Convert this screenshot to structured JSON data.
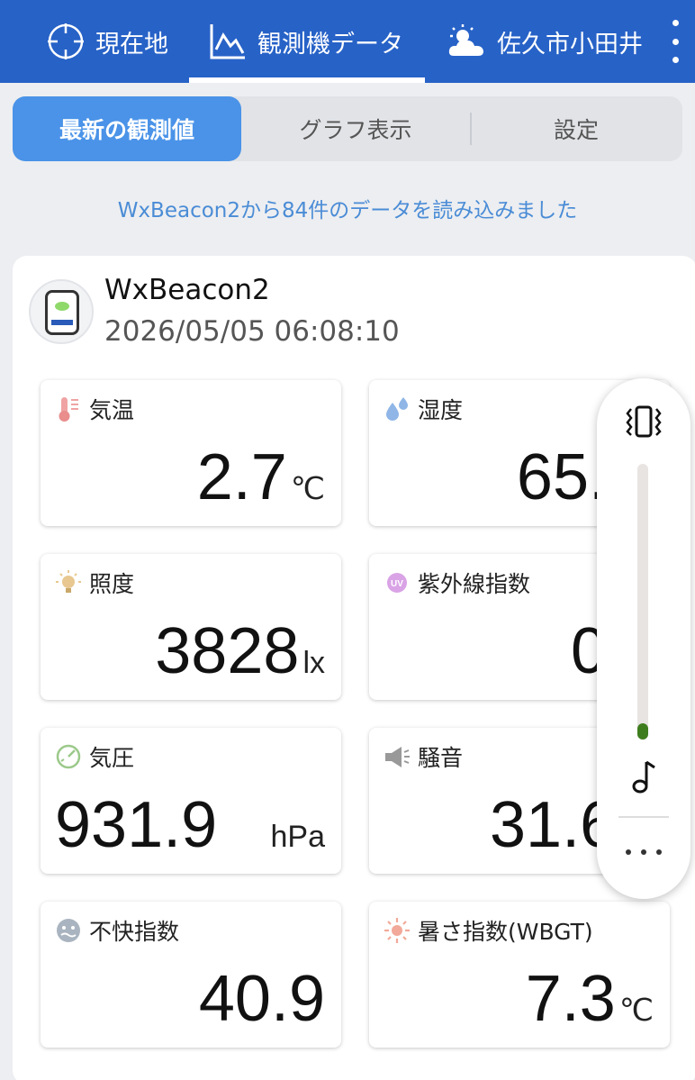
{
  "appbar": {
    "tabs": [
      {
        "label": "現在地",
        "icon": "crosshair-icon"
      },
      {
        "label": "観測機データ",
        "icon": "line-chart-icon"
      },
      {
        "label": "佐久市小田井",
        "icon": "partly-cloudy-icon"
      }
    ],
    "active_tab": 1
  },
  "segment": {
    "latest": "最新の観測値",
    "graph": "グラフ表示",
    "settings": "設定",
    "active": "latest"
  },
  "status_message": "WxBeacon2から84件のデータを読み込みました",
  "device": {
    "name": "WxBeacon2",
    "timestamp": "2026/05/05 06:08:10"
  },
  "metrics": {
    "temperature": {
      "label": "気温",
      "value": "2.7",
      "unit": "℃",
      "icon": "thermometer-icon"
    },
    "humidity": {
      "label": "湿度",
      "value": "65.",
      "unit": "",
      "icon": "water-drops-icon"
    },
    "illuminance": {
      "label": "照度",
      "value": "3828",
      "unit": "lx",
      "icon": "light-bulb-icon"
    },
    "uv": {
      "label": "紫外線指数",
      "value": "0",
      "unit": "",
      "icon": "uv-icon"
    },
    "pressure": {
      "label": "気圧",
      "value": "931.9",
      "unit": "hPa",
      "icon": "gauge-icon"
    },
    "noise": {
      "label": "騒音",
      "value": "31.6",
      "unit": "",
      "icon": "megaphone-icon"
    },
    "discomfort": {
      "label": "不快指数",
      "value": "40.9",
      "unit": "",
      "icon": "face-icon"
    },
    "wbgt": {
      "label": "暑さ指数(WBGT)",
      "value": "7.3",
      "unit": "℃",
      "icon": "sun-icon"
    }
  },
  "volume_panel": {
    "level_fraction": 0.05,
    "colors": {
      "fill": "#3e7d1e",
      "track": "#e8e4e2"
    }
  },
  "colors": {
    "appbar": "#2762c7",
    "segment_active": "#4a93e8",
    "status_text": "#4a8cd6"
  }
}
